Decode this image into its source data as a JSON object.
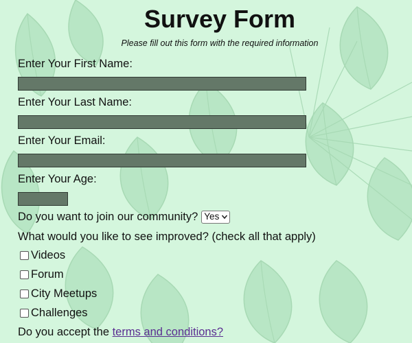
{
  "page": {
    "title": "Survey Form",
    "subtitle": "Please fill out this form with the required information"
  },
  "form": {
    "first_name_label": "Enter Your First Name:",
    "first_name_value": "",
    "last_name_label": "Enter Your Last Name:",
    "last_name_value": "",
    "email_label": "Enter Your Email:",
    "email_value": "",
    "age_label": "Enter Your Age:",
    "age_value": "",
    "community_question": "Do you want to join our community?",
    "community_selected": "Yes",
    "improve_question": "What would you like to see improved? (check all that apply)",
    "options": [
      {
        "label": "Videos",
        "checked": false
      },
      {
        "label": "Forum",
        "checked": false
      },
      {
        "label": "City Meetups",
        "checked": false
      },
      {
        "label": "Challenges",
        "checked": false
      }
    ],
    "terms_prefix": "Do you accept the",
    "terms_link": "terms and conditions?"
  },
  "colors": {
    "background": "#d4f6dd",
    "field_fill": "#647868",
    "link": "#5a2d91"
  },
  "icons": {
    "select": "chevron-down-icon",
    "background": "tropical-leaf-pattern"
  }
}
